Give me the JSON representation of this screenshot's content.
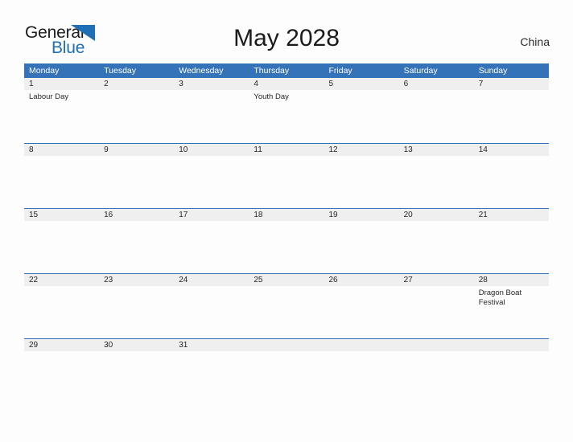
{
  "brand": {
    "name_part1": "General",
    "name_part2": "Blue",
    "flag_icon": "blue-triangle-flag-icon",
    "color_dark": "#1c1c1c",
    "color_blue": "#1f6fb5"
  },
  "header": {
    "title": "May 2028",
    "region": "China"
  },
  "theme": {
    "header_blue": "#3573b9",
    "row_gray": "#efefef",
    "page_background": "#fdfdfd",
    "text_color": "#262626"
  },
  "calendar": {
    "weekdays": [
      "Monday",
      "Tuesday",
      "Wednesday",
      "Thursday",
      "Friday",
      "Saturday",
      "Sunday"
    ],
    "weeks": [
      {
        "days": [
          {
            "num": "1",
            "event": "Labour Day"
          },
          {
            "num": "2",
            "event": ""
          },
          {
            "num": "3",
            "event": ""
          },
          {
            "num": "4",
            "event": "Youth Day"
          },
          {
            "num": "5",
            "event": ""
          },
          {
            "num": "6",
            "event": ""
          },
          {
            "num": "7",
            "event": ""
          }
        ]
      },
      {
        "days": [
          {
            "num": "8",
            "event": ""
          },
          {
            "num": "9",
            "event": ""
          },
          {
            "num": "10",
            "event": ""
          },
          {
            "num": "11",
            "event": ""
          },
          {
            "num": "12",
            "event": ""
          },
          {
            "num": "13",
            "event": ""
          },
          {
            "num": "14",
            "event": ""
          }
        ]
      },
      {
        "days": [
          {
            "num": "15",
            "event": ""
          },
          {
            "num": "16",
            "event": ""
          },
          {
            "num": "17",
            "event": ""
          },
          {
            "num": "18",
            "event": ""
          },
          {
            "num": "19",
            "event": ""
          },
          {
            "num": "20",
            "event": ""
          },
          {
            "num": "21",
            "event": ""
          }
        ]
      },
      {
        "days": [
          {
            "num": "22",
            "event": ""
          },
          {
            "num": "23",
            "event": ""
          },
          {
            "num": "24",
            "event": ""
          },
          {
            "num": "25",
            "event": ""
          },
          {
            "num": "26",
            "event": ""
          },
          {
            "num": "27",
            "event": ""
          },
          {
            "num": "28",
            "event": "Dragon Boat Festival"
          }
        ]
      },
      {
        "days": [
          {
            "num": "29",
            "event": ""
          },
          {
            "num": "30",
            "event": ""
          },
          {
            "num": "31",
            "event": ""
          },
          {
            "num": "",
            "event": ""
          },
          {
            "num": "",
            "event": ""
          },
          {
            "num": "",
            "event": ""
          },
          {
            "num": "",
            "event": ""
          }
        ]
      }
    ]
  }
}
